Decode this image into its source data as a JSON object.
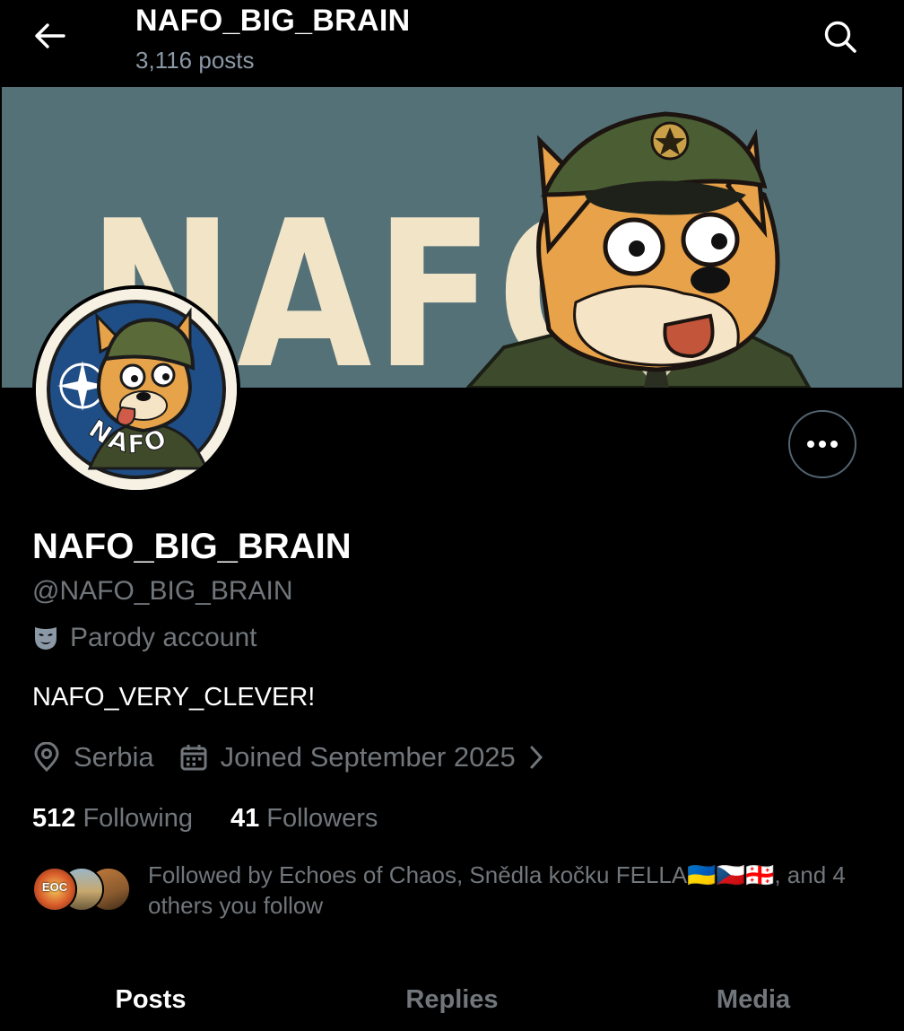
{
  "header": {
    "title": "NAFO_BIG_BRAIN",
    "post_count": "3,116 posts",
    "back_icon": "arrow-left-icon",
    "search_icon": "search-icon"
  },
  "banner": {
    "text": "NAFO",
    "bg_color": "#557178",
    "text_color": "#f2e5c7"
  },
  "avatar": {
    "label": "NAFO"
  },
  "profile": {
    "display_name": "NAFO_BIG_BRAIN",
    "handle": "@NAFO_BIG_BRAIN",
    "parody_label": "Parody account",
    "bio": "NAFO_VERY_CLEVER!",
    "location": "Serbia",
    "joined": "Joined September 2025"
  },
  "stats": {
    "following_count": "512",
    "following_label": "Following",
    "followers_count": "41",
    "followers_label": "Followers"
  },
  "followed_by": {
    "text": "Followed by Echoes of Chaos, Snědla kočku FELLA🇺🇦🇨🇿🇬🇪, and 4 others you follow",
    "first_avatar_label": "EOC"
  },
  "tabs": [
    {
      "label": "Posts",
      "active": true
    },
    {
      "label": "Replies",
      "active": false
    },
    {
      "label": "Media",
      "active": false
    }
  ]
}
